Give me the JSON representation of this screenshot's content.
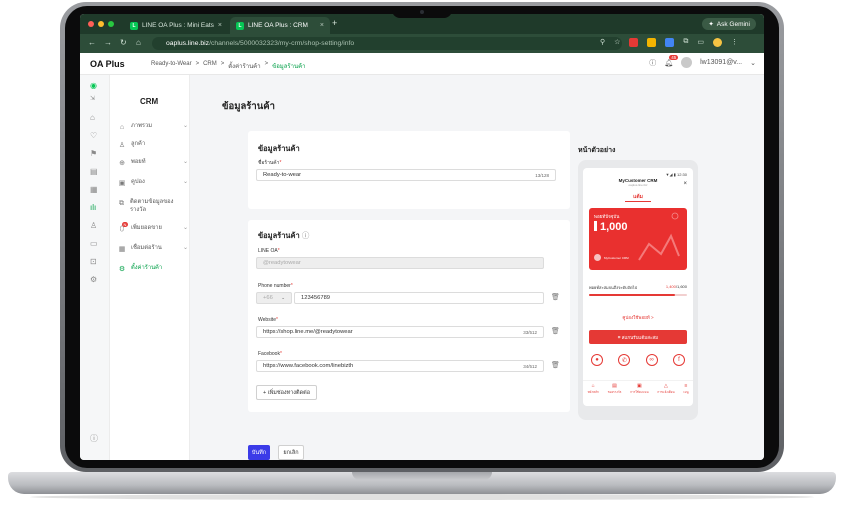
{
  "browser": {
    "tabs": [
      {
        "label": "LINE OA Plus : Mini Eats",
        "fav": "L"
      },
      {
        "label": "LINE OA Plus : CRM",
        "fav": "L"
      }
    ],
    "gemini_label": "Ask Gemini",
    "url_host": "oaplus.line.biz",
    "url_path": "/channels/5000032323/my-crm/shop-setting/info"
  },
  "app": {
    "logo": "OA Plus",
    "breadcrumb": [
      "Ready-to-Wear",
      ">",
      "CRM",
      ">",
      "ตั้งค่าร้านค้า",
      ">",
      "ข้อมูลร้านค้า"
    ],
    "notif_count": "45",
    "user": "lw13091@v..."
  },
  "sidebar": {
    "title": "CRM",
    "items": [
      {
        "label": "ภาพรวม",
        "icon": "home-icon",
        "chev": true
      },
      {
        "label": "ลูกค้า",
        "icon": "user-icon",
        "chev": false
      },
      {
        "label": "พอยท์",
        "icon": "points-icon",
        "chev": true
      },
      {
        "label": "คูปอง",
        "icon": "coupon-icon",
        "chev": true
      },
      {
        "label": "ติดตามข้อมูลของรางวัล",
        "icon": "gift-icon",
        "chev": false
      },
      {
        "label": "เพิ่มยอดขาย",
        "icon": "chart-icon",
        "chev": true,
        "badge": "N"
      },
      {
        "label": "เชื่อมต่อร้าน",
        "icon": "store-icon",
        "chev": true
      },
      {
        "label": "ตั้งค่าร้านค้า",
        "icon": "gear-icon",
        "chev": false,
        "active": true
      }
    ]
  },
  "page": {
    "title": "ข้อมูลร้านค้า",
    "card1": {
      "heading": "ข้อมูลร้านค้า",
      "name_label": "ชื่อร้านค้า",
      "name_value": "Ready-to-wear",
      "name_count": "13/128"
    },
    "card2": {
      "heading": "ข้อมูลร้านค้า",
      "lineoa_label": "LINE OA",
      "lineoa_placeholder": "@readytowear",
      "phone_label": "Phone number",
      "phone_code": "+66",
      "phone_value": "123456789",
      "website_label": "Website",
      "website_value": "https://shop.line.me/@readytowear",
      "website_count": "33/512",
      "facebook_label": "Facebook",
      "facebook_value": "https://www.facebook.com/linebizth",
      "facebook_count": "34/512",
      "add_contact": "+ เพิ่มช่องทางติดต่อ"
    },
    "save": "บันทึก",
    "cancel": "ยกเลิก"
  },
  "preview": {
    "title": "หน้าตัวอย่าง",
    "status": "▼◢ ▮ 12:30",
    "shop_name": "MyCustomer CRM",
    "shop_sub": "oaplus.line.biz",
    "tab": "แต้ม",
    "current_label": "พอยท์ปัจจุบัน",
    "points": "1,000",
    "member": "MyCustomer CRM",
    "progress_label": "พอยท์สะสมจนถึงระดับถัดไป",
    "progress_value": "1,400",
    "progress_total": "/1,600",
    "progress_fraction": 0.875,
    "coupon_link": "คูปองใช้พอยท์ >",
    "scan_button": "สแกนรับแต้มสะสม",
    "nav": [
      "หน้าหลัก",
      "ของรางวัล",
      "การใช้คะแนน",
      "การแจ้งเตือน",
      "เมนู"
    ]
  }
}
